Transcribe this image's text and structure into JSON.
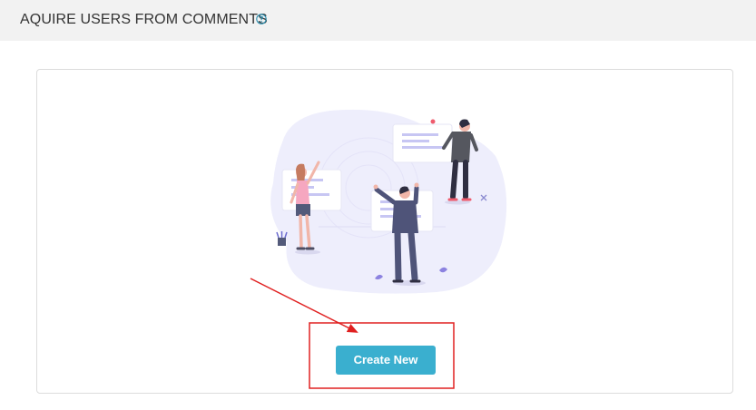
{
  "header": {
    "title": "AQUIRE USERS FROM COMMENTS",
    "help_icon": "question-circle-icon"
  },
  "main": {
    "illustration": "people-with-speech-bubbles-illustration",
    "create_button_label": "Create New"
  },
  "annotation": {
    "arrow_icon": "red-arrow",
    "highlight_box": "red-highlight-box",
    "color": "#e02020"
  },
  "colors": {
    "header_bg": "#f2f2f2",
    "accent": "#3aafcf",
    "card_border": "#dcdcdc",
    "blob": "#eeeefc",
    "bubble_lines": "#c7c6f3"
  }
}
